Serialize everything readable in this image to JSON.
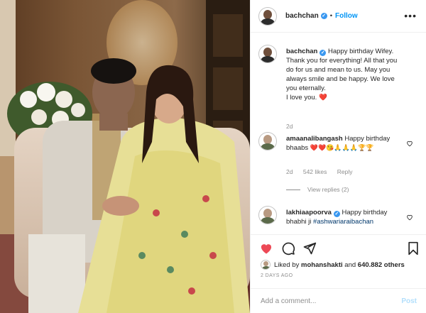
{
  "header": {
    "username": "bachchan",
    "separator": "•",
    "follow_label": "Follow",
    "more_label": "•••"
  },
  "caption": {
    "username": "bachchan",
    "text": "Happy birthday Wifey. Thank you for everything! All that you do for us and mean to us. May you always smile and be happy. We love you eternally.",
    "line2": "I love you.",
    "emoji": "❤️",
    "time": "2d"
  },
  "comments": [
    {
      "username": "amaanalibangash",
      "text": "Happy birthday bhaabs",
      "emojis": "❤️❤️😘🙏🙏🙏🏆🏆",
      "time": "2d",
      "likes": "542 likes",
      "reply_label": "Reply"
    },
    {
      "username": "lakhiaapoorva",
      "text": "Happy birthday bhabhi ji",
      "mention": "#ashwariaraibachan"
    }
  ],
  "view_replies": "View replies (2)",
  "likes_line": {
    "prefix": "Liked by",
    "user": "mohanshakti",
    "middle": "and",
    "count": "640.882 others"
  },
  "date_label": "2 DAYS AGO",
  "add_comment": {
    "placeholder": "Add a comment...",
    "post_label": "Post"
  },
  "colors": {
    "accent_blue": "#0095f6",
    "heart_red": "#ed4956",
    "post_disabled": "#b2dffc"
  },
  "icons": {
    "heart": "heart-icon",
    "comment": "comment-icon",
    "share": "share-icon",
    "save": "bookmark-icon"
  }
}
